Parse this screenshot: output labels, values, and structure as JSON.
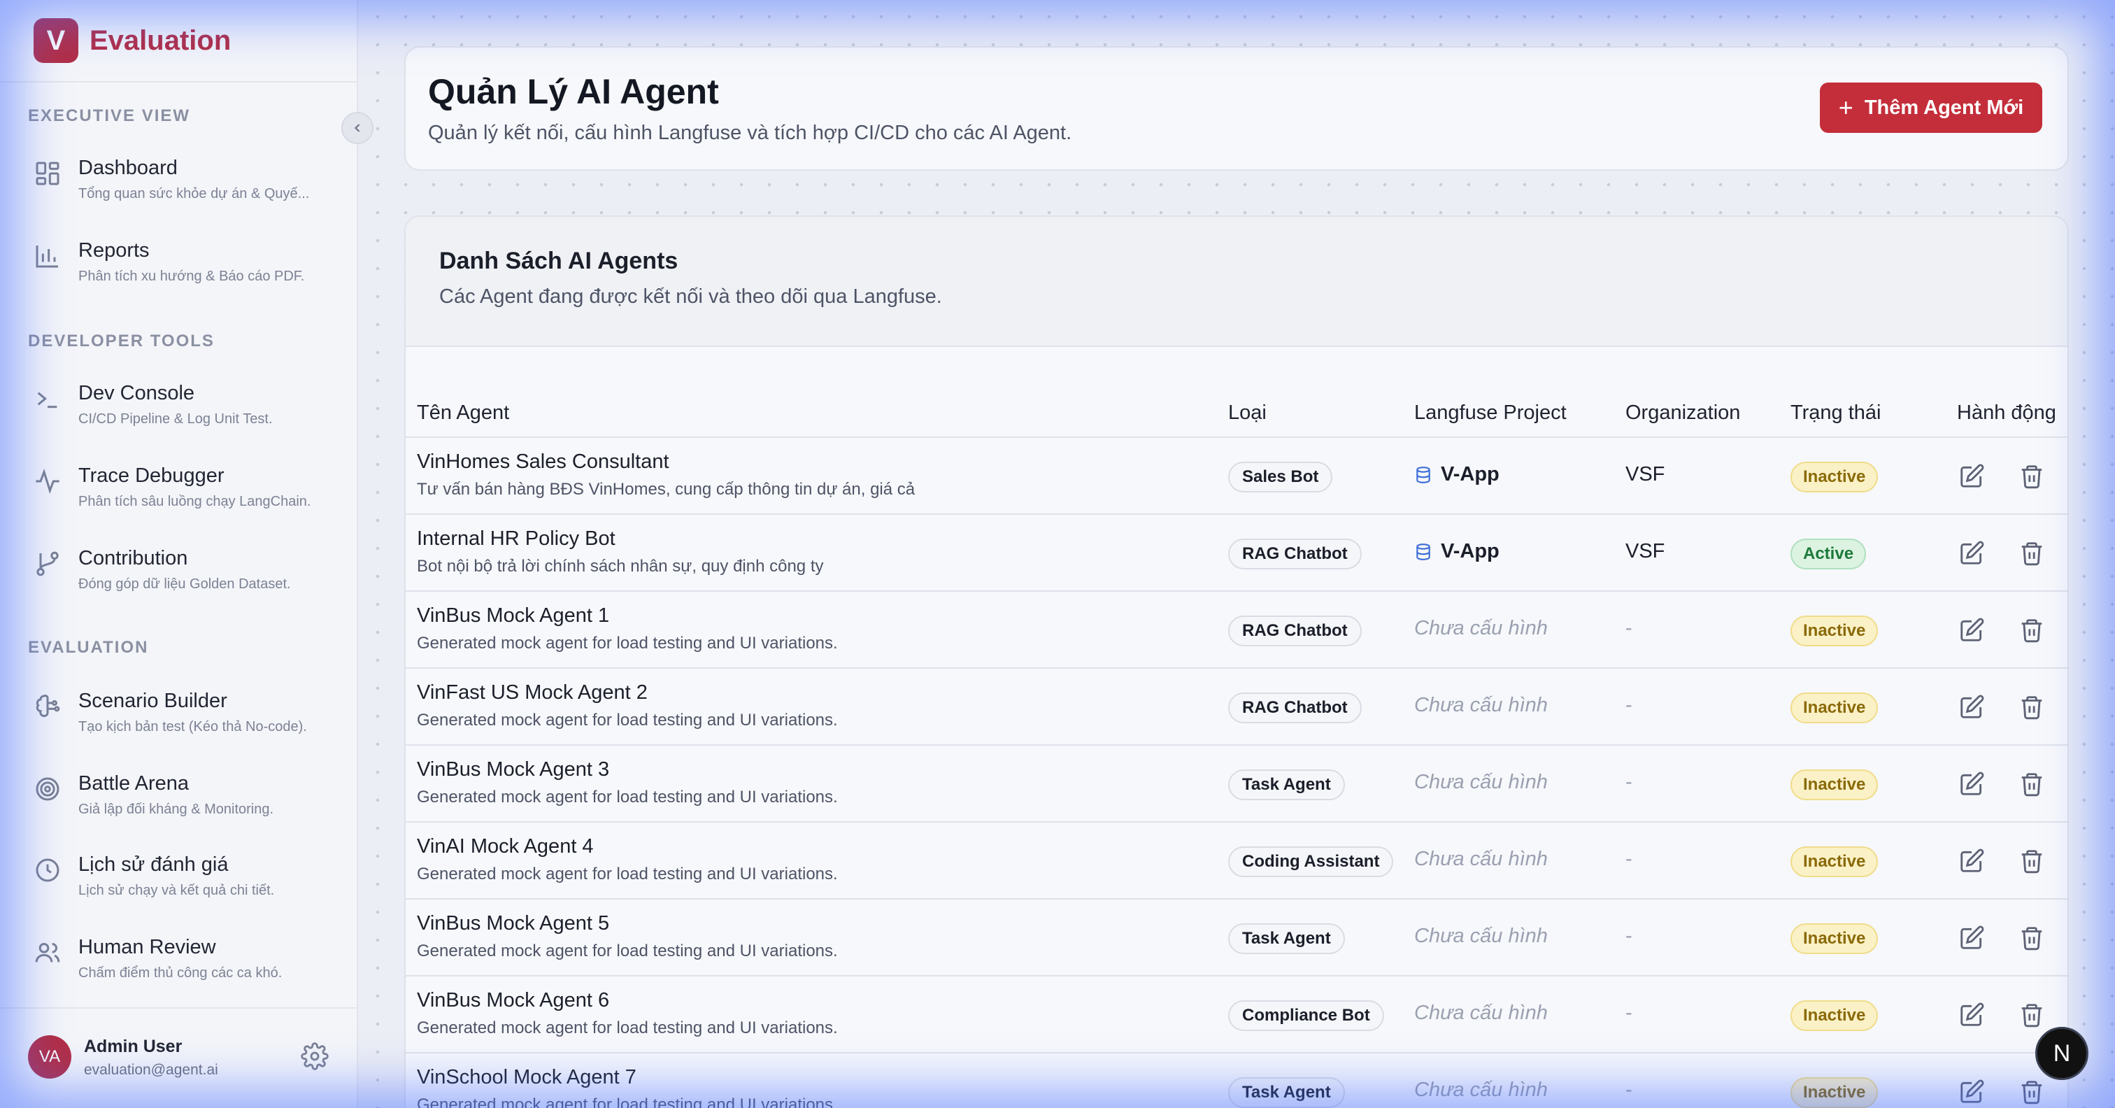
{
  "brand": {
    "logo_letter": "V",
    "name": "Evaluation"
  },
  "sidebar": {
    "sections": [
      {
        "title": "EXECUTIVE VIEW"
      },
      {
        "title": "DEVELOPER TOOLS"
      },
      {
        "title": "EVALUATION"
      }
    ],
    "items": [
      {
        "title": "Dashboard",
        "sub": "Tổng quan sức khỏe dự án & Quyế...",
        "icon": "dashboard-icon"
      },
      {
        "title": "Reports",
        "sub": "Phân tích xu hướng & Báo cáo PDF.",
        "icon": "bar-chart-icon"
      },
      {
        "title": "Dev Console",
        "sub": "CI/CD Pipeline & Log Unit Test.",
        "icon": "terminal-icon"
      },
      {
        "title": "Trace Debugger",
        "sub": "Phân tích sâu luồng chạy LangChain.",
        "icon": "activity-icon"
      },
      {
        "title": "Contribution",
        "sub": "Đóng góp dữ liệu Golden Dataset.",
        "icon": "git-branch-icon"
      },
      {
        "title": "Scenario Builder",
        "sub": "Tạo kịch bản test (Kéo thả No-code).",
        "icon": "brain-icon"
      },
      {
        "title": "Battle Arena",
        "sub": "Giả lập đối kháng & Monitoring.",
        "icon": "target-icon"
      },
      {
        "title": "Lịch sử đánh giá",
        "sub": "Lịch sử chạy và kết quả chi tiết.",
        "icon": "clock-icon"
      },
      {
        "title": "Human Review",
        "sub": "Chấm điểm thủ công các ca khó.",
        "icon": "users-icon"
      }
    ],
    "collapse_icon": "chevron-left-icon"
  },
  "user": {
    "initials": "VA",
    "name": "Admin User",
    "email": "evaluation@agent.ai"
  },
  "header": {
    "title": "Quản Lý AI Agent",
    "subtitle": "Quản lý kết nối, cấu hình Langfuse và tích hợp CI/CD cho các AI Agent.",
    "add_button": "Thêm Agent Mới"
  },
  "list": {
    "title": "Danh Sách AI Agents",
    "subtitle": "Các Agent đang được kết nối và theo dõi qua Langfuse.",
    "columns": [
      "Tên Agent",
      "Loại",
      "Langfuse Project",
      "Organization",
      "Trạng thái",
      "Hành động"
    ],
    "rows": [
      {
        "name": "VinHomes Sales Consultant",
        "desc": "Tư vấn bán hàng BĐS VinHomes, cung cấp thông tin dự án, giá cả",
        "type": "Sales Bot",
        "project": "V-App",
        "org": "VSF",
        "status": "Inactive"
      },
      {
        "name": "Internal HR Policy Bot",
        "desc": "Bot nội bộ trả lời chính sách nhân sự, quy định công ty",
        "type": "RAG Chatbot",
        "project": "V-App",
        "org": "VSF",
        "status": "Active"
      },
      {
        "name": "VinBus Mock Agent 1",
        "desc": "Generated mock agent for load testing and UI variations.",
        "type": "RAG Chatbot",
        "project": "Chưa cấu hình",
        "org": "-",
        "status": "Inactive"
      },
      {
        "name": "VinFast US Mock Agent 2",
        "desc": "Generated mock agent for load testing and UI variations.",
        "type": "RAG Chatbot",
        "project": "Chưa cấu hình",
        "org": "-",
        "status": "Inactive"
      },
      {
        "name": "VinBus Mock Agent 3",
        "desc": "Generated mock agent for load testing and UI variations.",
        "type": "Task Agent",
        "project": "Chưa cấu hình",
        "org": "-",
        "status": "Inactive"
      },
      {
        "name": "VinAI Mock Agent 4",
        "desc": "Generated mock agent for load testing and UI variations.",
        "type": "Coding Assistant",
        "project": "Chưa cấu hình",
        "org": "-",
        "status": "Inactive"
      },
      {
        "name": "VinBus Mock Agent 5",
        "desc": "Generated mock agent for load testing and UI variations.",
        "type": "Task Agent",
        "project": "Chưa cấu hình",
        "org": "-",
        "status": "Inactive"
      },
      {
        "name": "VinBus Mock Agent 6",
        "desc": "Generated mock agent for load testing and UI variations.",
        "type": "Compliance Bot",
        "project": "Chưa cấu hình",
        "org": "-",
        "status": "Inactive"
      },
      {
        "name": "VinSchool Mock Agent 7",
        "desc": "Generated mock agent for load testing and UI variations.",
        "type": "Task Agent",
        "project": "Chưa cấu hình",
        "org": "-",
        "status": "Inactive"
      }
    ]
  },
  "floating_badge": "N"
}
